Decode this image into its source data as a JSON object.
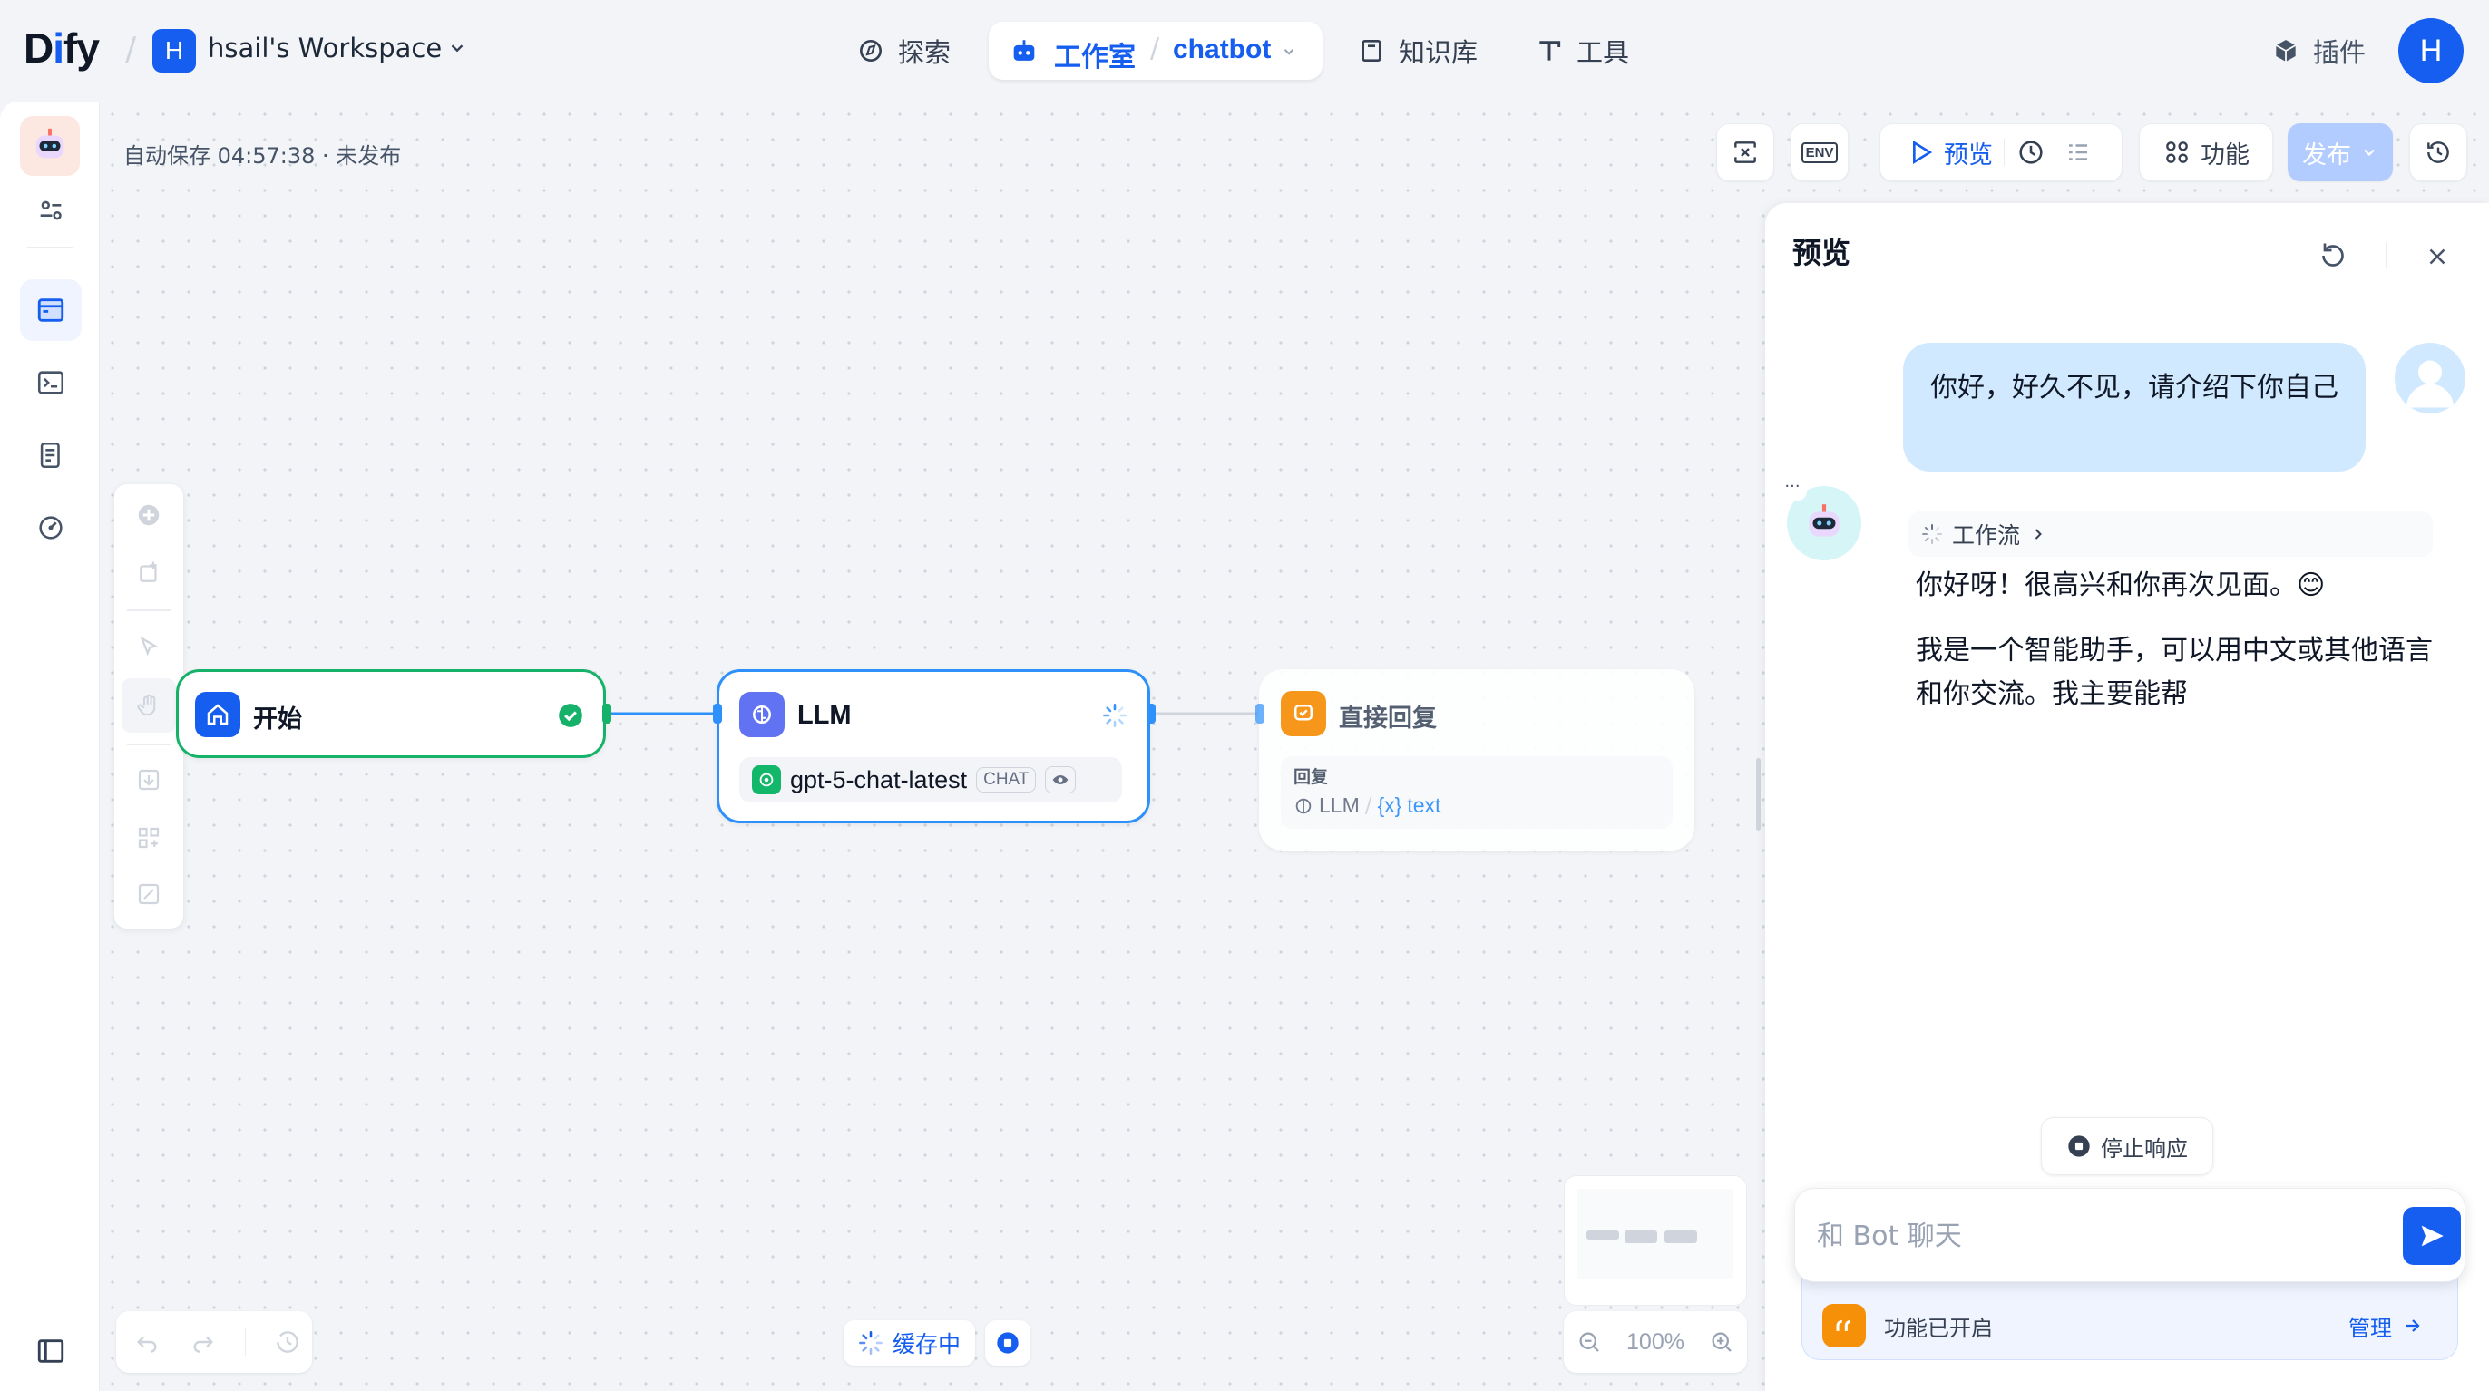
{
  "topbar": {
    "logo": "Dify",
    "workspace_initial": "H",
    "workspace_name": "hsail's Workspace",
    "nav_explore": "探索",
    "nav_studio": "工作室",
    "nav_app": "chatbot",
    "nav_knowledge": "知识库",
    "nav_tools": "工具",
    "plugins": "插件",
    "user_initial": "H"
  },
  "toolbar": {
    "autosave": "自动保存 04:57:38 · 未发布",
    "env_label": "ENV",
    "preview_label": "预览",
    "features_label": "功能",
    "publish_label": "发布"
  },
  "nodes": {
    "start": {
      "title": "开始"
    },
    "llm": {
      "title": "LLM",
      "model": "gpt-5-chat-latest",
      "mode_badge": "CHAT"
    },
    "answer": {
      "title": "直接回复",
      "field_label": "回复",
      "var_node": "LLM",
      "var_name": "text"
    }
  },
  "bottom": {
    "caching_label": "缓存中",
    "zoom": "100%"
  },
  "preview": {
    "title": "预览",
    "user_message": "你好，好久不见，请介绍下你自己",
    "workflow_label": "工作流",
    "bot_line1": "你好呀！很高兴和你再次见面。😊",
    "bot_line2": "我是一个智能助手，可以用中文或其他语言和你交流。我主要能帮",
    "stop_label": "停止响应",
    "input_placeholder": "和 Bot 聊天",
    "features_enabled": "功能已开启",
    "manage_label": "管理"
  },
  "colors": {
    "primary": "#155eef",
    "start_border": "#17b26a",
    "answer_icon": "#f79009",
    "user_bubble": "#d1e9ff"
  }
}
